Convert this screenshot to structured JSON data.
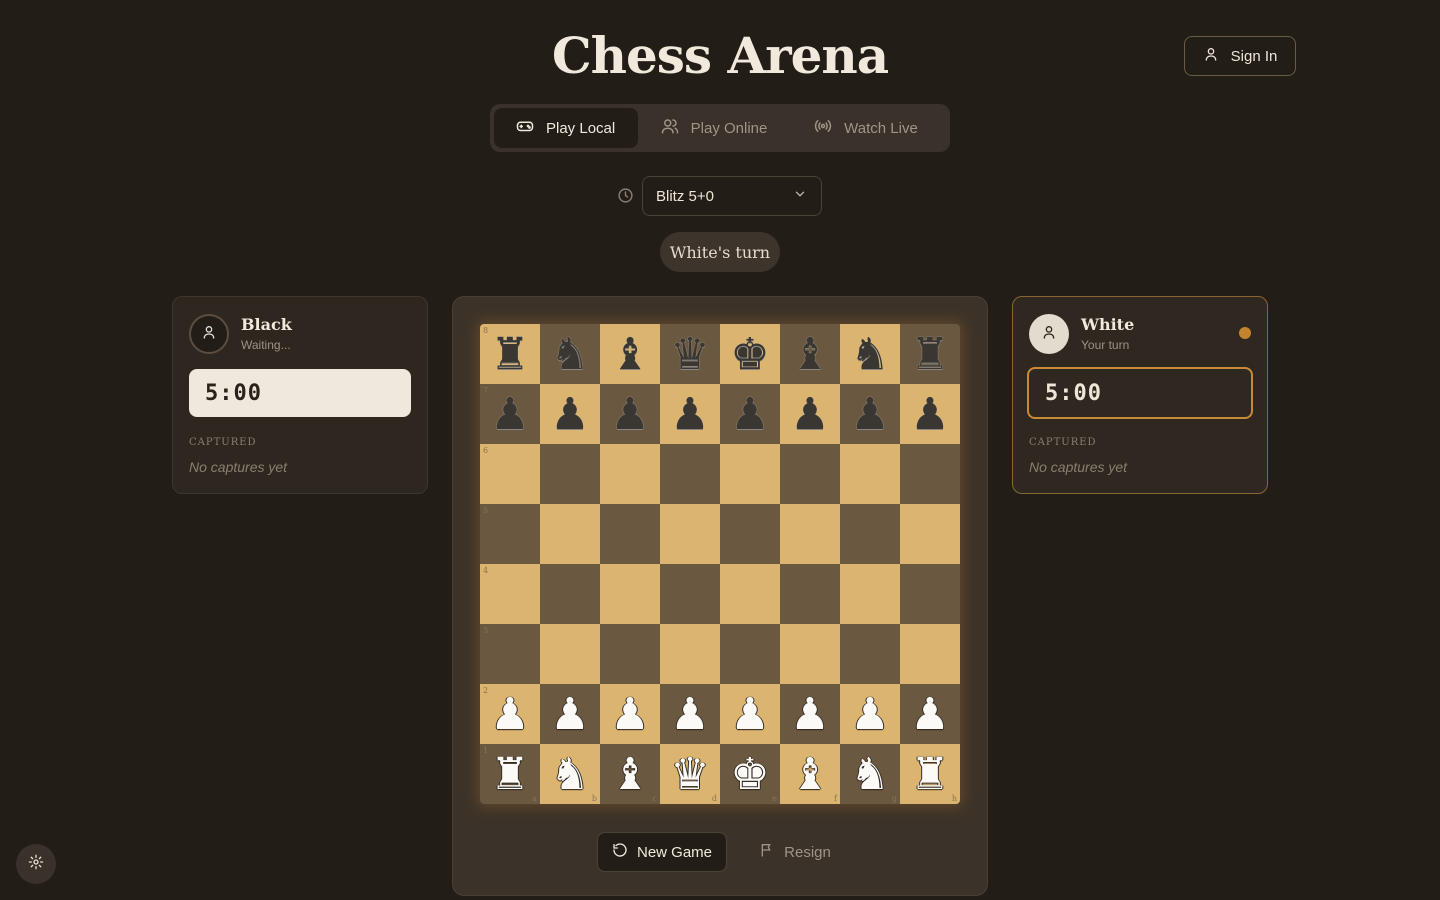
{
  "app": {
    "title": "Chess Arena"
  },
  "header": {
    "signin_label": "Sign In"
  },
  "tabs": [
    {
      "label": "Play Local",
      "icon": "gamepad-icon",
      "active": true
    },
    {
      "label": "Play Online",
      "icon": "users-icon",
      "active": false
    },
    {
      "label": "Watch Live",
      "icon": "broadcast-icon",
      "active": false
    }
  ],
  "time_control": {
    "selected": "Blitz 5+0"
  },
  "turn_indicator": "White's turn",
  "players": {
    "black": {
      "name": "Black",
      "status": "Waiting...",
      "time": "5:00",
      "captured_label": "CAPTURED",
      "captured_empty": "No captures yet"
    },
    "white": {
      "name": "White",
      "status": "Your turn",
      "time": "5:00",
      "captured_label": "CAPTURED",
      "captured_empty": "No captures yet",
      "active": true
    }
  },
  "board": {
    "ranks": [
      "8",
      "7",
      "6",
      "5",
      "4",
      "3",
      "2",
      "1"
    ],
    "files": [
      "a",
      "b",
      "c",
      "d",
      "e",
      "f",
      "g",
      "h"
    ],
    "rows": [
      [
        "br",
        "bn",
        "bb",
        "bq",
        "bk",
        "bb",
        "bn",
        "br"
      ],
      [
        "bp",
        "bp",
        "bp",
        "bp",
        "bp",
        "bp",
        "bp",
        "bp"
      ],
      [
        "",
        "",
        "",
        "",
        "",
        "",
        "",
        ""
      ],
      [
        "",
        "",
        "",
        "",
        "",
        "",
        "",
        ""
      ],
      [
        "",
        "",
        "",
        "",
        "",
        "",
        "",
        ""
      ],
      [
        "",
        "",
        "",
        "",
        "",
        "",
        "",
        ""
      ],
      [
        "wp",
        "wp",
        "wp",
        "wp",
        "wp",
        "wp",
        "wp",
        "wp"
      ],
      [
        "wr",
        "wn",
        "wb",
        "wq",
        "wk",
        "wb",
        "wn",
        "wr"
      ]
    ]
  },
  "actions": {
    "new_game_label": "New Game",
    "resign_label": "Resign"
  },
  "colors": {
    "accent": "#c98a36",
    "light_square": "#dbb46f",
    "dark_square": "#6b5840",
    "background": "#231d17"
  }
}
